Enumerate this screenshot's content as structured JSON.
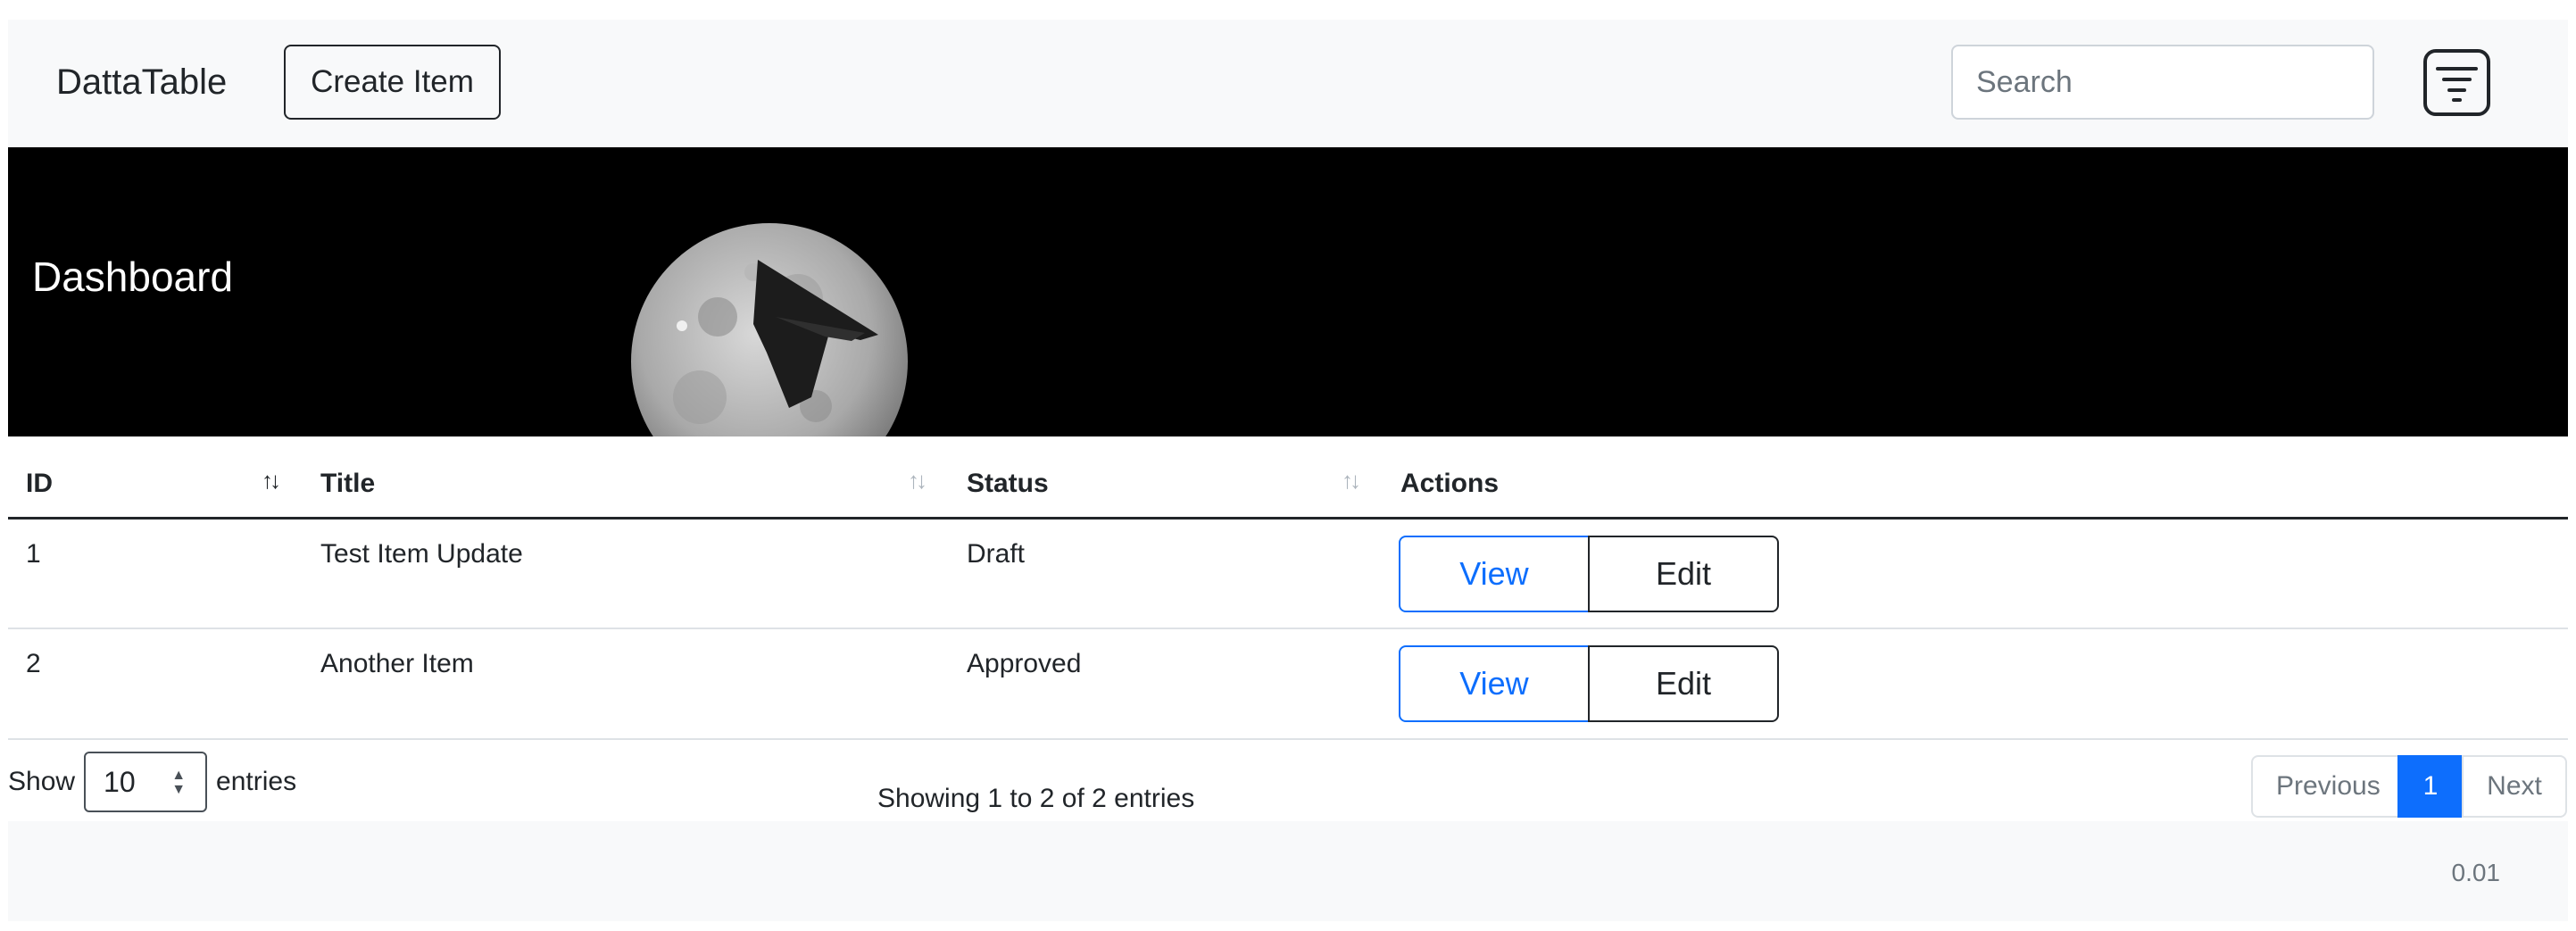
{
  "navbar": {
    "brand": "DattaTable",
    "create_label": "Create Item",
    "search_placeholder": "Search",
    "filter_icon": "filter-lines-icon"
  },
  "hero": {
    "title": "Dashboard",
    "image": "moon-with-stealth-bomber"
  },
  "table": {
    "headers": [
      "ID",
      "Title",
      "Status",
      "Actions"
    ],
    "rows": [
      {
        "id": "1",
        "title": "Test Item Update",
        "status": "Draft",
        "view_label": "View",
        "edit_label": "Edit"
      },
      {
        "id": "2",
        "title": "Another Item",
        "status": "Approved",
        "view_label": "View",
        "edit_label": "Edit"
      }
    ]
  },
  "length": {
    "prefix": "Show",
    "value": "10",
    "suffix": "entries"
  },
  "info": "Showing 1 to 2 of 2 entries",
  "pagination": {
    "previous": "Previous",
    "current": "1",
    "next": "Next"
  },
  "footer": {
    "version": "0.01"
  },
  "colors": {
    "primary": "#0d6efd",
    "dark": "#212529",
    "light_bg": "#f8f9fa"
  }
}
